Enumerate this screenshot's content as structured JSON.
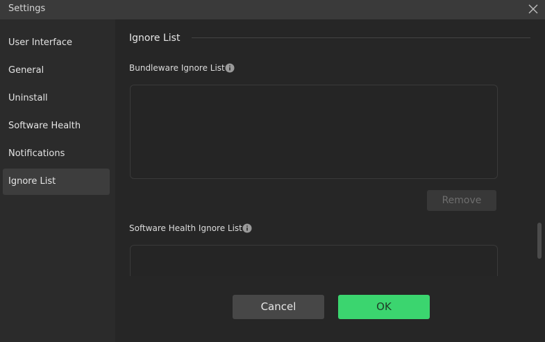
{
  "window": {
    "title": "Settings"
  },
  "sidebar": {
    "items": [
      {
        "label": "User Interface"
      },
      {
        "label": "General"
      },
      {
        "label": "Uninstall"
      },
      {
        "label": "Software Health"
      },
      {
        "label": "Notifications"
      },
      {
        "label": "Ignore List",
        "active": true
      }
    ]
  },
  "main": {
    "section_title": "Ignore List",
    "bundleware": {
      "label": "Bundleware Ignore List",
      "info_icon": "info-icon",
      "remove_label": "Remove"
    },
    "software_health": {
      "label": "Software Health Ignore List",
      "info_icon": "info-icon"
    }
  },
  "footer": {
    "cancel_label": "Cancel",
    "ok_label": "OK"
  },
  "colors": {
    "accent_green": "#3bd56f",
    "background": "#262626",
    "sidebar": "#2b2b2b",
    "titlebar": "#3a3a3a"
  }
}
